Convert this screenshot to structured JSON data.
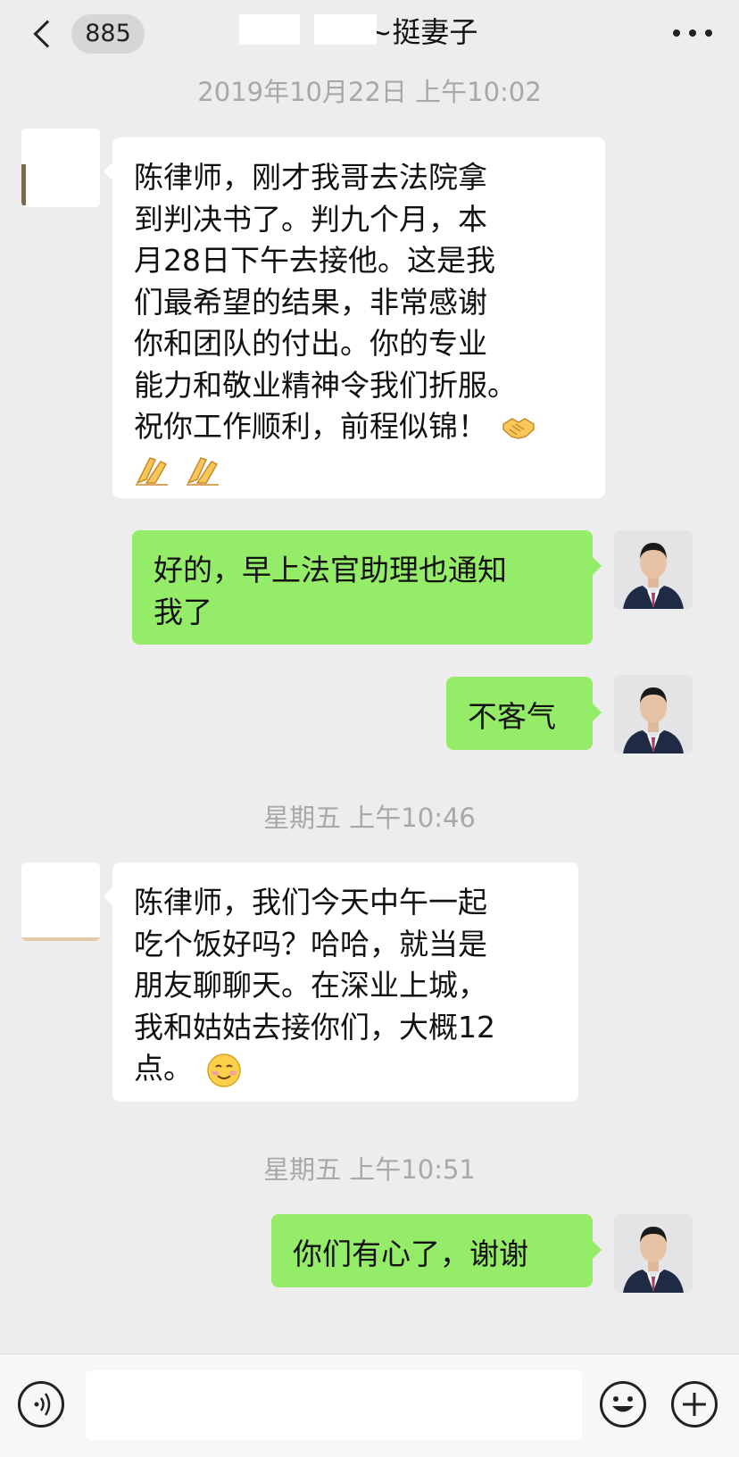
{
  "header": {
    "unread_count": "885",
    "title": "~挺妻子"
  },
  "messages": [
    {
      "type": "timestamp",
      "text": "2019年10月22日 上午10:02"
    },
    {
      "type": "in",
      "lines": [
        "陈律师，刚才我哥去法院拿",
        "到判决书了。判九个月，本",
        "月28日下午去接他。这是我",
        "们最希望的结果，非常感谢",
        "你和团队的付出。你的专业",
        "能力和敬业精神令我们折服。",
        "祝你工作顺利，前程似锦！"
      ],
      "emojis": [
        "handshake",
        "clap",
        "clap"
      ]
    },
    {
      "type": "out",
      "lines": [
        "好的，早上法官助理也通知",
        "我了"
      ]
    },
    {
      "type": "out",
      "lines": [
        "不客气"
      ]
    },
    {
      "type": "timestamp",
      "text": "星期五 上午10:46"
    },
    {
      "type": "in",
      "lines": [
        "陈律师，我们今天中午一起",
        "吃个饭好吗？哈哈，就当是",
        "朋友聊聊天。在深业上城，",
        "我和姑姑去接你们，大概12",
        "点。"
      ],
      "emojis": [
        "smile"
      ]
    },
    {
      "type": "timestamp",
      "text": "星期五 上午10:51"
    },
    {
      "type": "out",
      "lines": [
        "你们有心了，谢谢"
      ]
    }
  ],
  "input_bar": {
    "voice_icon": "voice-icon",
    "emoji_icon": "emoji-icon",
    "plus_icon": "plus-icon"
  }
}
